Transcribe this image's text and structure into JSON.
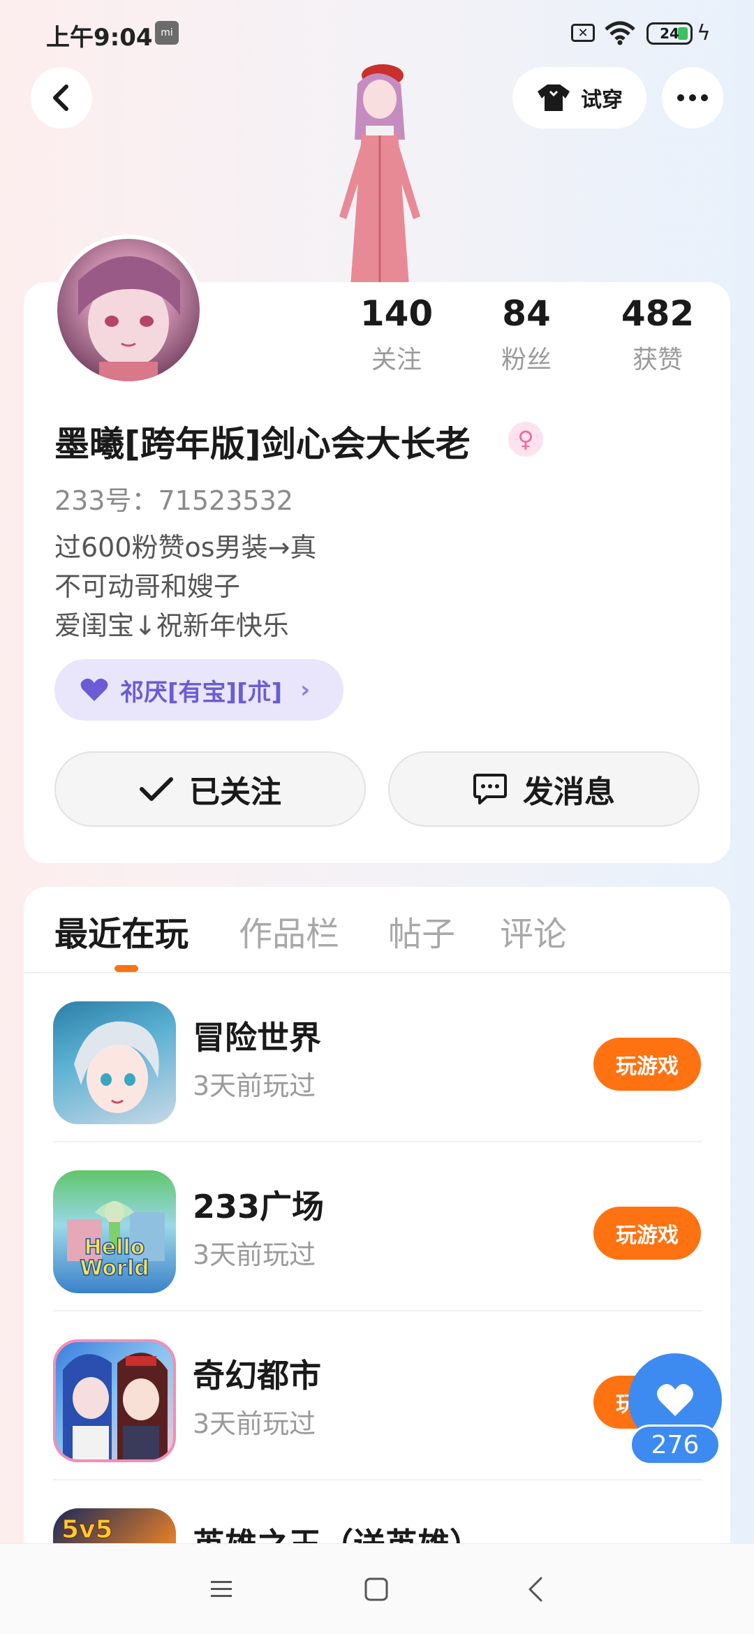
{
  "status_bar": {
    "time": "上午9:04",
    "mi_label": "mi",
    "battery": "24"
  },
  "header": {
    "tryon_label": "试穿"
  },
  "profile": {
    "stats": [
      {
        "value": "140",
        "label": "关注"
      },
      {
        "value": "84",
        "label": "粉丝"
      },
      {
        "value": "482",
        "label": "获赞"
      }
    ],
    "nickname": "墨曦[跨年版]剑心会大长老",
    "user_id": "233号：71523532",
    "bio_lines": [
      "过600粉赞os男装→真",
      "不可动哥和嫂子",
      "爱闺宝↓祝新年快乐"
    ],
    "guild": "祁厌[有宝][朮]",
    "follow_label": "已关注",
    "message_label": "发消息"
  },
  "tabs": [
    "最近在玩",
    "作品栏",
    "帖子",
    "评论"
  ],
  "games": [
    {
      "name": "冒险世界",
      "sub": "3天前玩过",
      "button": "玩游戏"
    },
    {
      "name": "233广场",
      "sub": "3天前玩过",
      "button": "玩游戏"
    },
    {
      "name": "奇幻都市",
      "sub": "3天前玩过",
      "button": "玩游戏"
    },
    {
      "name": "英雄之王（送英雄）",
      "sub": "",
      "button": ""
    }
  ],
  "game_icon_text": {
    "hello_world": "Hello World",
    "five_v_five": "5v5"
  },
  "likes": {
    "count": "276"
  },
  "colors": {
    "accent": "#ff7212",
    "like_blue": "#3d8bf0",
    "guild_bg": "#e9e6fb",
    "guild_text": "#6a5cd4"
  },
  "icons": [
    "back-icon",
    "shirt-icon",
    "more-icon",
    "check-icon",
    "chat-icon",
    "heart-icon",
    "menu-icon",
    "home-icon",
    "nav-back-icon"
  ]
}
